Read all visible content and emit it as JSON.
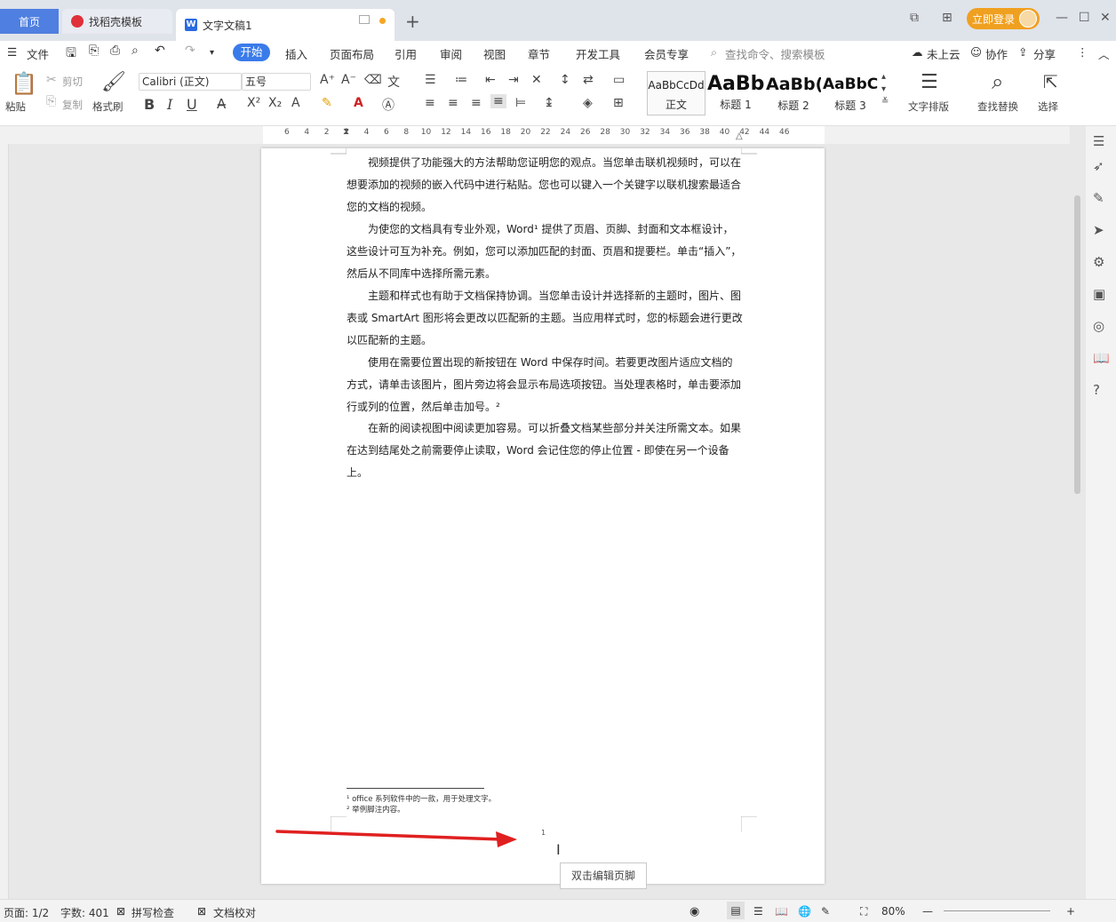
{
  "titlebar": {
    "tab_home": "首页",
    "tab_templates": "找稻壳模板",
    "tab_doc": "文字文稿1",
    "new_tab": "+",
    "login": "立即登录"
  },
  "menubar": {
    "file": "文件",
    "items": [
      "开始",
      "插入",
      "页面布局",
      "引用",
      "审阅",
      "视图",
      "章节",
      "开发工具",
      "会员专享"
    ],
    "search_placeholder": "查找命令、搜索模板",
    "cloud": "未上云",
    "collab": "协作",
    "share": "分享"
  },
  "ribbon": {
    "paste": "粘贴",
    "cut": "剪切",
    "copy": "复制",
    "format_painter": "格式刷",
    "font_name": "Calibri (正文)",
    "font_size": "五号",
    "styles": [
      {
        "preview": "AaBbCcDd",
        "label": "正文"
      },
      {
        "preview": "AaBb",
        "label": "标题 1"
      },
      {
        "preview": "AaBb(",
        "label": "标题 2"
      },
      {
        "preview": "AaBbC(",
        "label": "标题 3"
      }
    ],
    "text_layout": "文字排版",
    "find_replace": "查找替换",
    "select": "选择"
  },
  "ruler": {
    "numbers": [
      "6",
      "4",
      "2",
      "2",
      "4",
      "6",
      "8",
      "10",
      "12",
      "14",
      "16",
      "18",
      "20",
      "22",
      "24",
      "26",
      "28",
      "30",
      "32",
      "34",
      "36",
      "38",
      "40",
      "42",
      "44",
      "46"
    ]
  },
  "document": {
    "paragraphs": [
      "视频提供了功能强大的方法帮助您证明您的观点。当您单击联机视频时，可以在想要添加的视频的嵌入代码中进行粘贴。您也可以键入一个关键字以联机搜索最适合您的文档的视频。",
      "为使您的文档具有专业外观，Word¹ 提供了页眉、页脚、封面和文本框设计，这些设计可互为补充。例如，您可以添加匹配的封面、页眉和提要栏。单击“插入”，然后从不同库中选择所需元素。",
      "主题和样式也有助于文档保持协调。当您单击设计并选择新的主题时，图片、图表或 SmartArt 图形将会更改以匹配新的主题。当应用样式时，您的标题会进行更改以匹配新的主题。",
      "使用在需要位置出现的新按钮在 Word 中保存时间。若要更改图片适应文档的方式，请单击该图片，图片旁边将会显示布局选项按钮。当处理表格时，单击要添加行或列的位置，然后单击加号。²",
      "在新的阅读视图中阅读更加容易。可以折叠文档某些部分并关注所需文本。如果在达到结尾处之前需要停止读取，Word 会记住您的停止位置 - 即使在另一个设备上。"
    ],
    "footnotes": [
      "¹ office 系列软件中的一款，用于处理文字。",
      "² 举例脚注内容。"
    ],
    "page_number": "1",
    "footer_tooltip": "双击编辑页脚"
  },
  "statusbar": {
    "page": "页面: 1/2",
    "words": "字数: 401",
    "spell": "拼写检查",
    "proof": "文档校对",
    "zoom": "80%"
  },
  "colors": {
    "accent": "#3a7bea",
    "login": "#f0a020",
    "arrow": "#e02020"
  }
}
